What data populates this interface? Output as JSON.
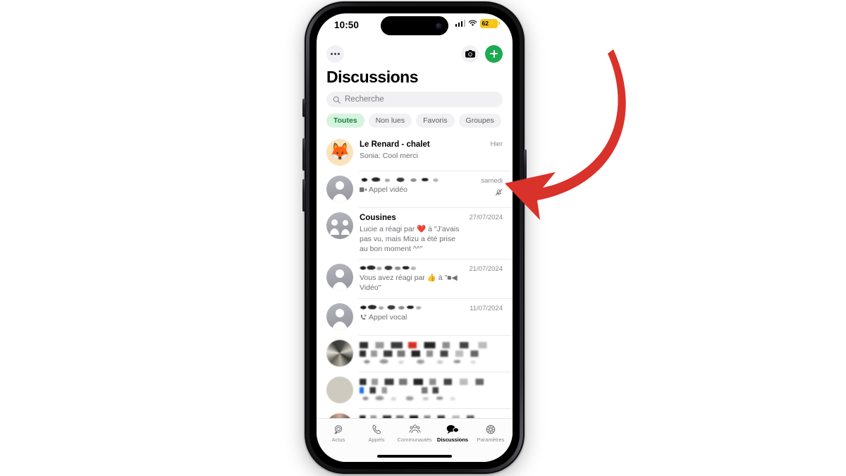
{
  "status_bar": {
    "time": "10:50",
    "signal_icon": "cellular-signal-icon",
    "wifi_icon": "wifi-icon",
    "battery_level": "62",
    "battery_bolt": "⚡",
    "battery_state_color": "#f5c518"
  },
  "header": {
    "more_icon": "more-horizontal-icon",
    "camera_icon": "camera-icon",
    "compose_icon": "plus-icon",
    "compose_color": "#1bab51",
    "title": "Discussions"
  },
  "search": {
    "icon": "search-icon",
    "placeholder": "Recherche",
    "value": ""
  },
  "filters": [
    {
      "label": "Toutes",
      "active": true
    },
    {
      "label": "Non lues",
      "active": false
    },
    {
      "label": "Favoris",
      "active": false
    },
    {
      "label": "Groupes",
      "active": false
    }
  ],
  "chats": [
    {
      "avatar_type": "emoji",
      "avatar_glyph": "🦊",
      "title": "Le Renard - chalet",
      "subtitle": "Sonia: Cool merci",
      "time": "Hier",
      "muted": false,
      "redacted": false
    },
    {
      "avatar_type": "person",
      "avatar_glyph": "",
      "title": "",
      "title_redacted": true,
      "subtitle": "Appel vidéo",
      "subtitle_icon": "video-call-icon",
      "time": "samedi",
      "muted": true,
      "mute_icon": "bell-muted-icon",
      "redacted": true
    },
    {
      "avatar_type": "group",
      "avatar_glyph": "",
      "title": "Cousines",
      "subtitle": "Lucie a réagi par ❤️ à \"J'avais pas vu, mais Mizu a été prise au bon moment ^^\"",
      "time": "27/07/2024",
      "muted": false,
      "redacted": false
    },
    {
      "avatar_type": "person",
      "avatar_glyph": "",
      "title": "",
      "title_redacted": true,
      "subtitle": "Vous avez réagi par 👍 à \"■◀ Vidéo\"",
      "time": "21/07/2024",
      "muted": false,
      "redacted": true
    },
    {
      "avatar_type": "person",
      "avatar_glyph": "",
      "title": "",
      "title_redacted": true,
      "subtitle": "Appel vocal",
      "subtitle_icon": "missed-voice-call-icon",
      "time": "11/07/2024",
      "muted": false,
      "redacted": true
    },
    {
      "avatar_type": "pixelated",
      "avatar_glyph": "",
      "title": "",
      "title_redacted": true,
      "subtitle": "",
      "time": "",
      "muted": false,
      "redacted": true
    },
    {
      "avatar_type": "pixelated",
      "avatar_glyph": "",
      "title": "",
      "title_redacted": true,
      "subtitle": "",
      "time": "",
      "muted": false,
      "redacted": true
    },
    {
      "avatar_type": "pixelated",
      "avatar_glyph": "",
      "title": "",
      "title_redacted": true,
      "subtitle": "",
      "time": "",
      "muted": false,
      "redacted": true
    }
  ],
  "tabs": [
    {
      "label": "Actus",
      "icon": "status-rings-icon",
      "active": false
    },
    {
      "label": "Appels",
      "icon": "phone-icon",
      "active": false
    },
    {
      "label": "Communautés",
      "icon": "communities-icon",
      "active": false
    },
    {
      "label": "Discussions",
      "icon": "chat-bubbles-icon",
      "active": true
    },
    {
      "label": "Paramètres",
      "icon": "gear-icon",
      "active": false
    }
  ],
  "annotation": {
    "shape": "curved-down-left-arrow",
    "color": "#d9322a",
    "points_at": "muted-chat-row"
  }
}
